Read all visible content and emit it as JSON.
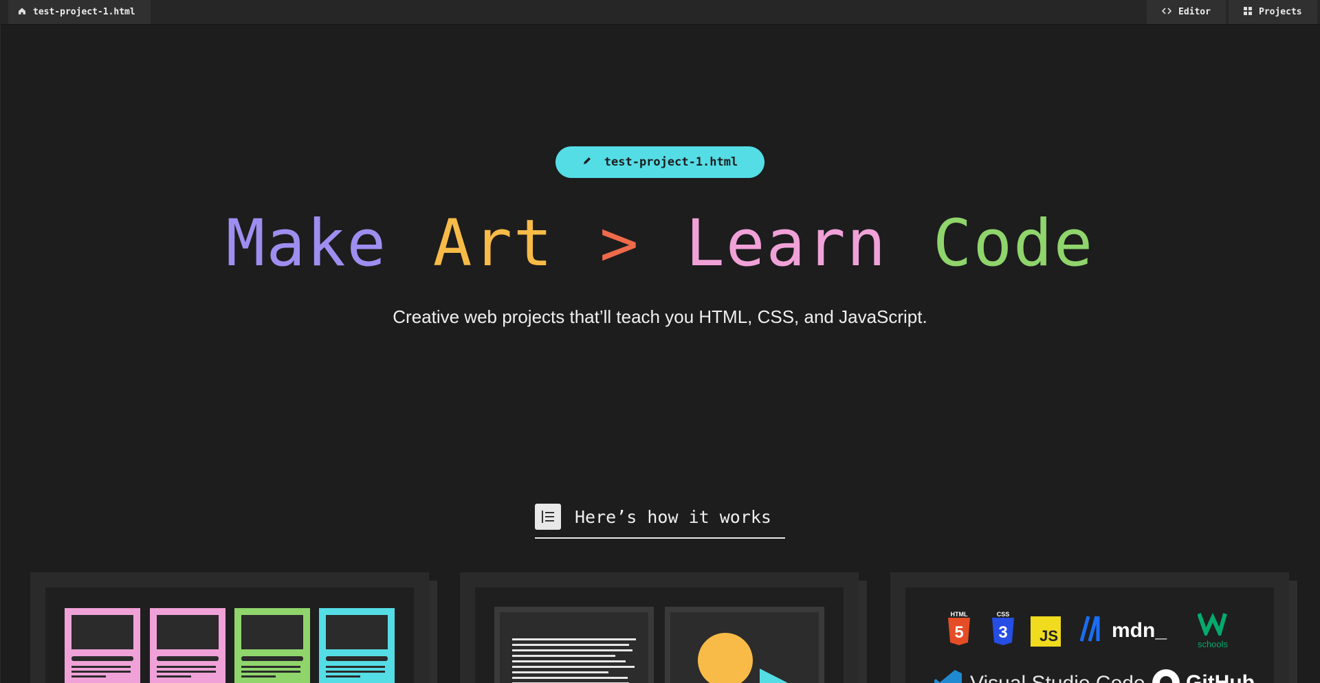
{
  "topbar": {
    "file_tab": "test-project-1.html",
    "editor_label": "Editor",
    "projects_label": "Projects"
  },
  "hero": {
    "pill_label": "test-project-1.html",
    "headline": {
      "make": "Make",
      "art": "Art",
      "gt": ">",
      "learn": "Learn",
      "code": "Code"
    },
    "subtitle": "Creative web projects that’ll teach you HTML, CSS, and JavaScript."
  },
  "how": {
    "title": "Here’s how it works"
  },
  "logos": {
    "html": "HTML",
    "css": "CSS",
    "js": "JS",
    "mdn": "mdn_",
    "w3": "schools",
    "vscode": "Visual Studio Code",
    "github": "GitHub"
  },
  "colors": {
    "make": "#9f8ef0",
    "art": "#f8bb47",
    "gt": "#ee6a4a",
    "learn": "#f0a2d8",
    "code": "#8fd56c",
    "pill": "#55dde6"
  }
}
